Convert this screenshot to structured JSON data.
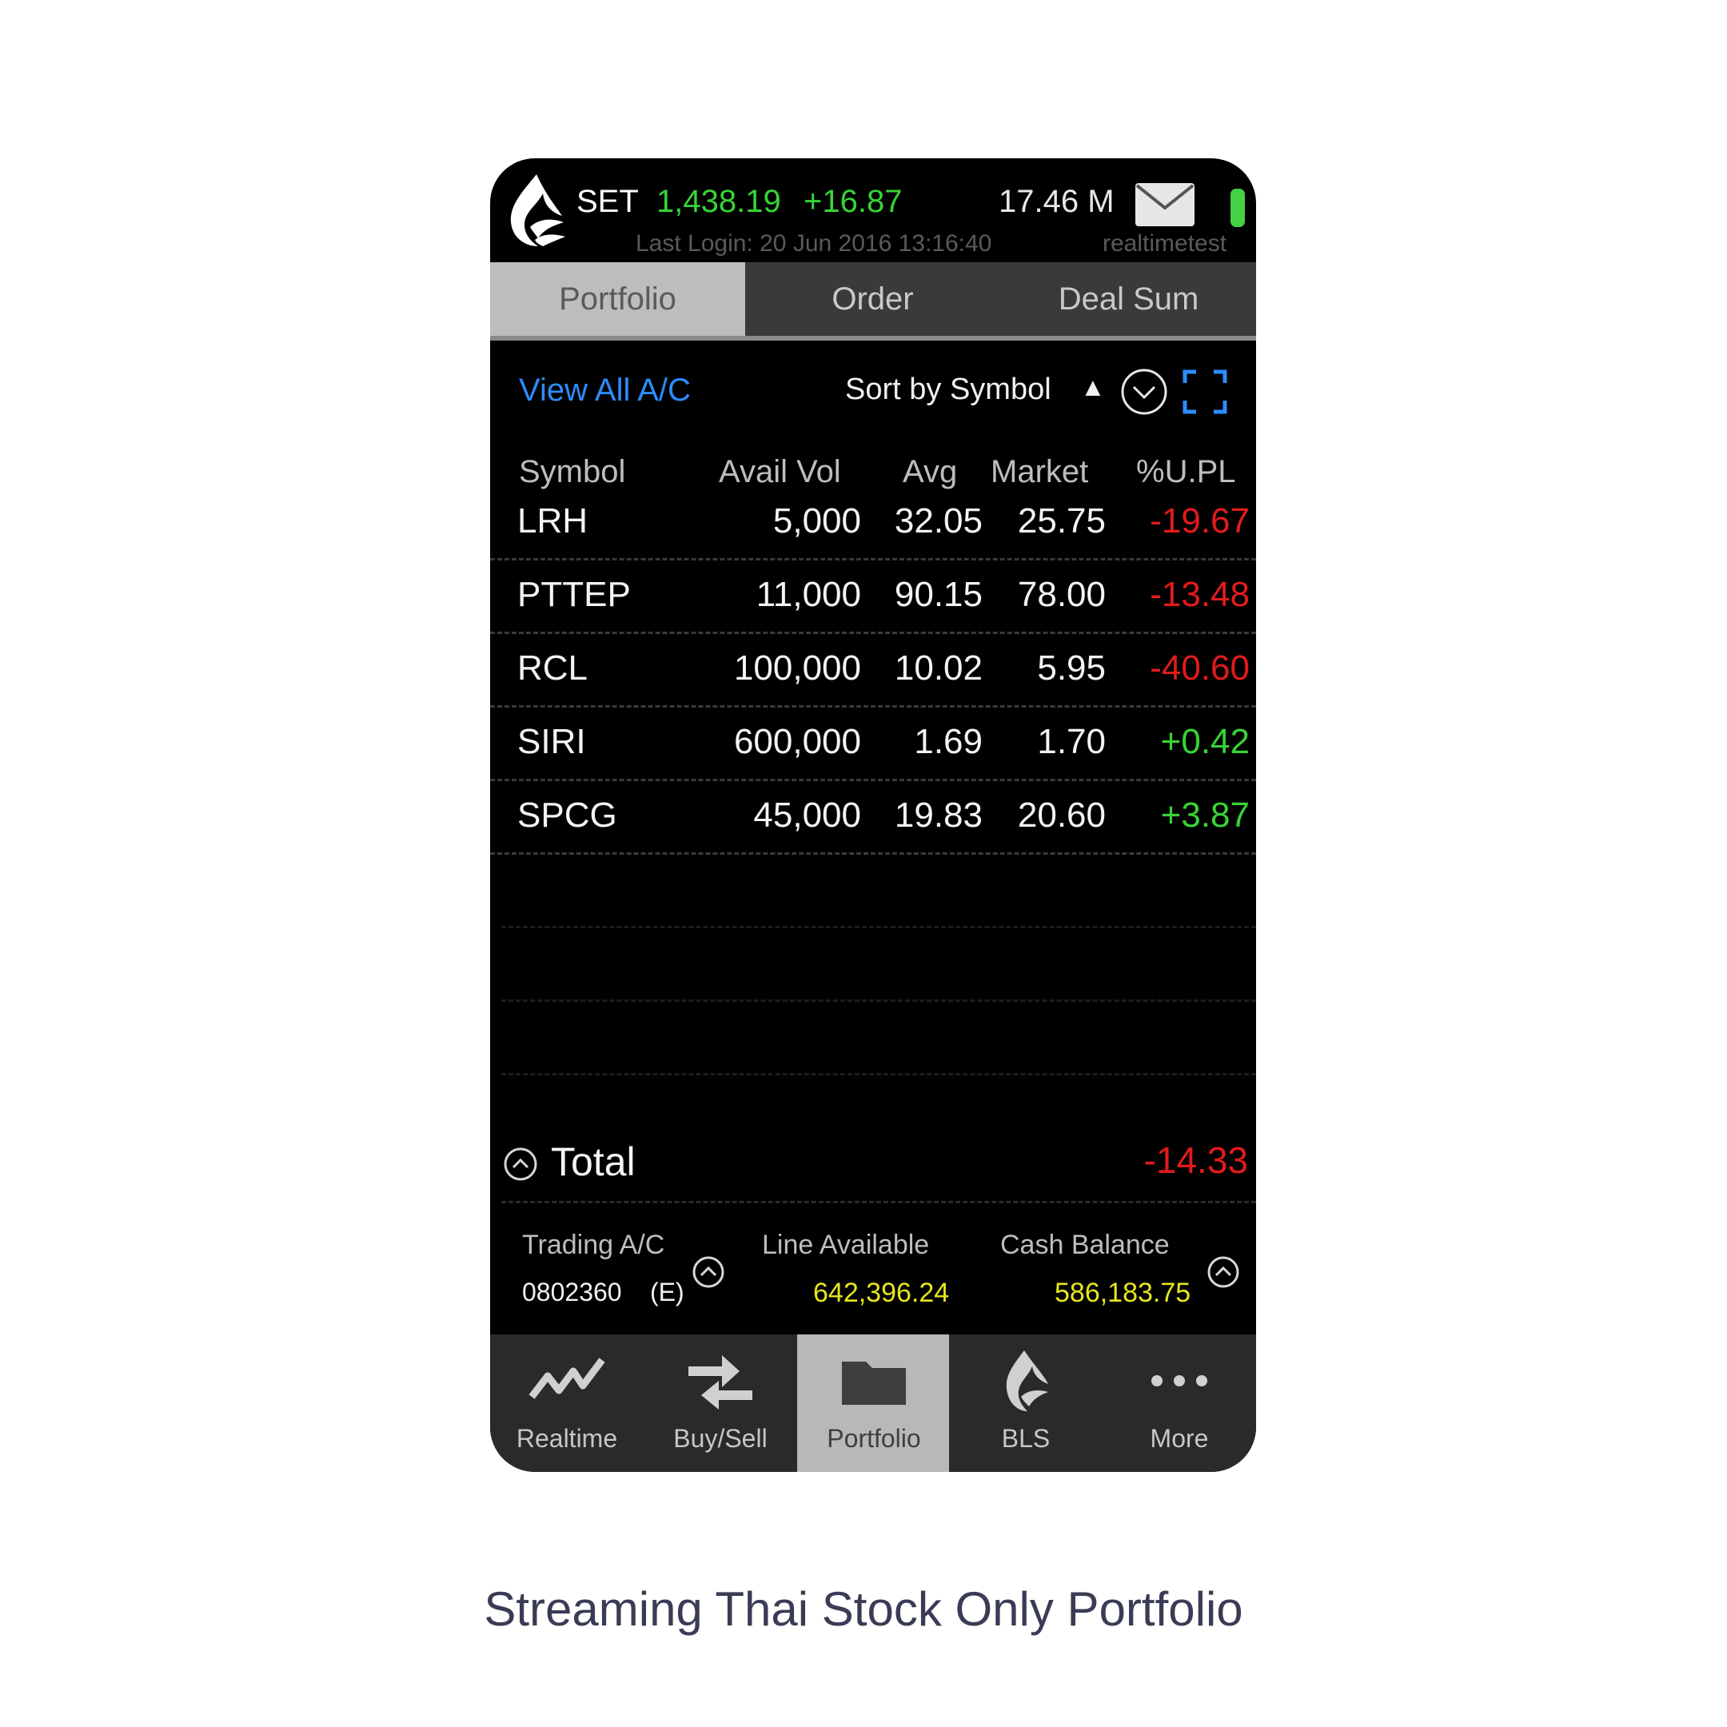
{
  "status": {
    "index_name": "SET",
    "index_value": "1,438.19",
    "index_change": "+16.87",
    "volume": "17.46 M",
    "last_login": "Last Login: 20 Jun 2016 13:16:40",
    "username": "realtimetest",
    "icons": {
      "logo": "flame-logo-icon",
      "mail": "envelope-icon",
      "battery": "battery-icon"
    }
  },
  "tabs": [
    {
      "label": "Portfolio",
      "active": true
    },
    {
      "label": "Order",
      "active": false
    },
    {
      "label": "Deal Sum",
      "active": false
    }
  ],
  "toolbar": {
    "view_all": "View All A/C",
    "sort_label": "Sort by Symbol",
    "sort_arrow": "▲",
    "icons": {
      "dropdown": "chevron-down-circle-icon",
      "expand": "fullscreen-icon"
    }
  },
  "table": {
    "headers": [
      "Symbol",
      "Avail Vol",
      "Avg",
      "Market",
      "%U.PL"
    ],
    "rows": [
      {
        "symbol": "LRH",
        "avail_vol": "5,000",
        "avg": "32.05",
        "market": "25.75",
        "upl": "-19.67"
      },
      {
        "symbol": "PTTEP",
        "avail_vol": "11,000",
        "avg": "90.15",
        "market": "78.00",
        "upl": "-13.48"
      },
      {
        "symbol": "RCL",
        "avail_vol": "100,000",
        "avg": "10.02",
        "market": "5.95",
        "upl": "-40.60"
      },
      {
        "symbol": "SIRI",
        "avail_vol": "600,000",
        "avg": "1.69",
        "market": "1.70",
        "upl": "+0.42"
      },
      {
        "symbol": "SPCG",
        "avail_vol": "45,000",
        "avg": "19.83",
        "market": "20.60",
        "upl": "+3.87"
      }
    ]
  },
  "total": {
    "label": "Total",
    "value": "-14.33",
    "icon": "chevron-up-circle-icon"
  },
  "account": {
    "trading_label": "Trading A/C",
    "trading_value": "0802360",
    "trading_type": "(E)",
    "line_label": "Line Available",
    "line_value": "642,396.24",
    "cash_label": "Cash Balance",
    "cash_value": "586,183.75"
  },
  "nav": [
    {
      "label": "Realtime",
      "icon": "chart-line-icon",
      "active": false
    },
    {
      "label": "Buy/Sell",
      "icon": "swap-arrows-icon",
      "active": false
    },
    {
      "label": "Portfolio",
      "icon": "folder-icon",
      "active": true
    },
    {
      "label": "BLS",
      "icon": "flame-logo-icon",
      "active": false
    },
    {
      "label": "More",
      "icon": "more-dots-icon",
      "active": false
    }
  ],
  "caption": "Streaming Thai Stock Only Portfolio",
  "colors": {
    "positive": "#37d437",
    "negative": "#e21b1b",
    "link": "#2c8cff",
    "highlight": "#e6e61e"
  }
}
